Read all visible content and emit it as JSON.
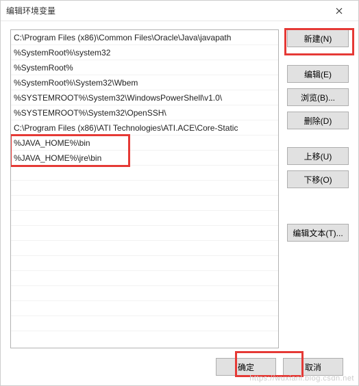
{
  "window": {
    "title": "编辑环境变量"
  },
  "list": {
    "items": [
      "C:\\Program Files (x86)\\Common Files\\Oracle\\Java\\javapath",
      "%SystemRoot%\\system32",
      "%SystemRoot%",
      "%SystemRoot%\\System32\\Wbem",
      "%SYSTEMROOT%\\System32\\WindowsPowerShell\\v1.0\\",
      "%SYSTEMROOT%\\System32\\OpenSSH\\",
      "C:\\Program Files (x86)\\ATI Technologies\\ATI.ACE\\Core-Static",
      "%JAVA_HOME%\\bin",
      "%JAVA_HOME%\\jre\\bin"
    ]
  },
  "buttons": {
    "new": "新建(N)",
    "edit": "编辑(E)",
    "browse": "浏览(B)...",
    "delete": "删除(D)",
    "moveup": "上移(U)",
    "movedown": "下移(O)",
    "edittext": "编辑文本(T)...",
    "ok": "确定",
    "cancel": "取消"
  },
  "watermark": "https://wuxianl.blog.csdn.net"
}
